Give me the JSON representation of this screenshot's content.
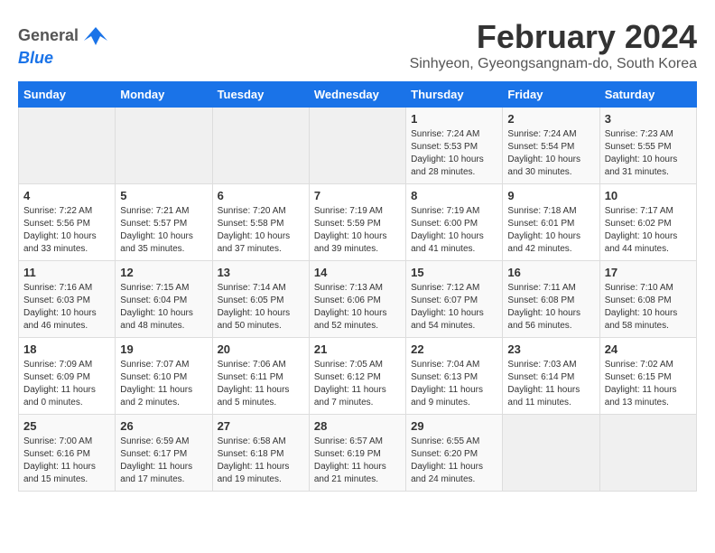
{
  "header": {
    "logo_line1": "General",
    "logo_line2": "Blue",
    "title": "February 2024",
    "subtitle": "Sinhyeon, Gyeongsangnam-do, South Korea"
  },
  "weekdays": [
    "Sunday",
    "Monday",
    "Tuesday",
    "Wednesday",
    "Thursday",
    "Friday",
    "Saturday"
  ],
  "weeks": [
    [
      {
        "day": "",
        "sunrise": "",
        "sunset": "",
        "daylight": ""
      },
      {
        "day": "",
        "sunrise": "",
        "sunset": "",
        "daylight": ""
      },
      {
        "day": "",
        "sunrise": "",
        "sunset": "",
        "daylight": ""
      },
      {
        "day": "",
        "sunrise": "",
        "sunset": "",
        "daylight": ""
      },
      {
        "day": "1",
        "sunrise": "Sunrise: 7:24 AM",
        "sunset": "Sunset: 5:53 PM",
        "daylight": "Daylight: 10 hours and 28 minutes."
      },
      {
        "day": "2",
        "sunrise": "Sunrise: 7:24 AM",
        "sunset": "Sunset: 5:54 PM",
        "daylight": "Daylight: 10 hours and 30 minutes."
      },
      {
        "day": "3",
        "sunrise": "Sunrise: 7:23 AM",
        "sunset": "Sunset: 5:55 PM",
        "daylight": "Daylight: 10 hours and 31 minutes."
      }
    ],
    [
      {
        "day": "4",
        "sunrise": "Sunrise: 7:22 AM",
        "sunset": "Sunset: 5:56 PM",
        "daylight": "Daylight: 10 hours and 33 minutes."
      },
      {
        "day": "5",
        "sunrise": "Sunrise: 7:21 AM",
        "sunset": "Sunset: 5:57 PM",
        "daylight": "Daylight: 10 hours and 35 minutes."
      },
      {
        "day": "6",
        "sunrise": "Sunrise: 7:20 AM",
        "sunset": "Sunset: 5:58 PM",
        "daylight": "Daylight: 10 hours and 37 minutes."
      },
      {
        "day": "7",
        "sunrise": "Sunrise: 7:19 AM",
        "sunset": "Sunset: 5:59 PM",
        "daylight": "Daylight: 10 hours and 39 minutes."
      },
      {
        "day": "8",
        "sunrise": "Sunrise: 7:19 AM",
        "sunset": "Sunset: 6:00 PM",
        "daylight": "Daylight: 10 hours and 41 minutes."
      },
      {
        "day": "9",
        "sunrise": "Sunrise: 7:18 AM",
        "sunset": "Sunset: 6:01 PM",
        "daylight": "Daylight: 10 hours and 42 minutes."
      },
      {
        "day": "10",
        "sunrise": "Sunrise: 7:17 AM",
        "sunset": "Sunset: 6:02 PM",
        "daylight": "Daylight: 10 hours and 44 minutes."
      }
    ],
    [
      {
        "day": "11",
        "sunrise": "Sunrise: 7:16 AM",
        "sunset": "Sunset: 6:03 PM",
        "daylight": "Daylight: 10 hours and 46 minutes."
      },
      {
        "day": "12",
        "sunrise": "Sunrise: 7:15 AM",
        "sunset": "Sunset: 6:04 PM",
        "daylight": "Daylight: 10 hours and 48 minutes."
      },
      {
        "day": "13",
        "sunrise": "Sunrise: 7:14 AM",
        "sunset": "Sunset: 6:05 PM",
        "daylight": "Daylight: 10 hours and 50 minutes."
      },
      {
        "day": "14",
        "sunrise": "Sunrise: 7:13 AM",
        "sunset": "Sunset: 6:06 PM",
        "daylight": "Daylight: 10 hours and 52 minutes."
      },
      {
        "day": "15",
        "sunrise": "Sunrise: 7:12 AM",
        "sunset": "Sunset: 6:07 PM",
        "daylight": "Daylight: 10 hours and 54 minutes."
      },
      {
        "day": "16",
        "sunrise": "Sunrise: 7:11 AM",
        "sunset": "Sunset: 6:08 PM",
        "daylight": "Daylight: 10 hours and 56 minutes."
      },
      {
        "day": "17",
        "sunrise": "Sunrise: 7:10 AM",
        "sunset": "Sunset: 6:08 PM",
        "daylight": "Daylight: 10 hours and 58 minutes."
      }
    ],
    [
      {
        "day": "18",
        "sunrise": "Sunrise: 7:09 AM",
        "sunset": "Sunset: 6:09 PM",
        "daylight": "Daylight: 11 hours and 0 minutes."
      },
      {
        "day": "19",
        "sunrise": "Sunrise: 7:07 AM",
        "sunset": "Sunset: 6:10 PM",
        "daylight": "Daylight: 11 hours and 2 minutes."
      },
      {
        "day": "20",
        "sunrise": "Sunrise: 7:06 AM",
        "sunset": "Sunset: 6:11 PM",
        "daylight": "Daylight: 11 hours and 5 minutes."
      },
      {
        "day": "21",
        "sunrise": "Sunrise: 7:05 AM",
        "sunset": "Sunset: 6:12 PM",
        "daylight": "Daylight: 11 hours and 7 minutes."
      },
      {
        "day": "22",
        "sunrise": "Sunrise: 7:04 AM",
        "sunset": "Sunset: 6:13 PM",
        "daylight": "Daylight: 11 hours and 9 minutes."
      },
      {
        "day": "23",
        "sunrise": "Sunrise: 7:03 AM",
        "sunset": "Sunset: 6:14 PM",
        "daylight": "Daylight: 11 hours and 11 minutes."
      },
      {
        "day": "24",
        "sunrise": "Sunrise: 7:02 AM",
        "sunset": "Sunset: 6:15 PM",
        "daylight": "Daylight: 11 hours and 13 minutes."
      }
    ],
    [
      {
        "day": "25",
        "sunrise": "Sunrise: 7:00 AM",
        "sunset": "Sunset: 6:16 PM",
        "daylight": "Daylight: 11 hours and 15 minutes."
      },
      {
        "day": "26",
        "sunrise": "Sunrise: 6:59 AM",
        "sunset": "Sunset: 6:17 PM",
        "daylight": "Daylight: 11 hours and 17 minutes."
      },
      {
        "day": "27",
        "sunrise": "Sunrise: 6:58 AM",
        "sunset": "Sunset: 6:18 PM",
        "daylight": "Daylight: 11 hours and 19 minutes."
      },
      {
        "day": "28",
        "sunrise": "Sunrise: 6:57 AM",
        "sunset": "Sunset: 6:19 PM",
        "daylight": "Daylight: 11 hours and 21 minutes."
      },
      {
        "day": "29",
        "sunrise": "Sunrise: 6:55 AM",
        "sunset": "Sunset: 6:20 PM",
        "daylight": "Daylight: 11 hours and 24 minutes."
      },
      {
        "day": "",
        "sunrise": "",
        "sunset": "",
        "daylight": ""
      },
      {
        "day": "",
        "sunrise": "",
        "sunset": "",
        "daylight": ""
      }
    ]
  ]
}
